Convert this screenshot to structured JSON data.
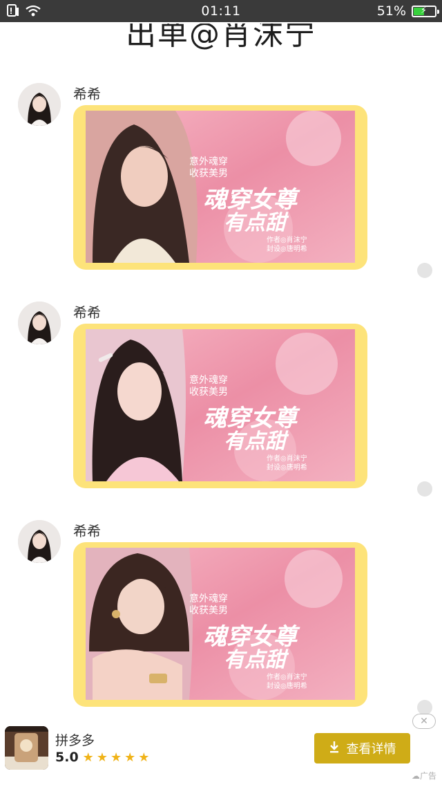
{
  "status_bar": {
    "time": "01:11",
    "battery": "51%",
    "battery_level": 0.51,
    "left_icons": [
      "notification-icon",
      "wifi-icon"
    ]
  },
  "page": {
    "title": "出单@肖沫宁"
  },
  "messages": [
    {
      "sender": "希希",
      "cover_text": {
        "line1": "意外魂穿",
        "line2": "收获美男",
        "main1": "魂穿女尊",
        "main2": "有点甜",
        "credit1": "作者◎肖沫宁",
        "credit2": "封设◎唐明希"
      }
    },
    {
      "sender": "希希",
      "cover_text": {
        "line1": "意外魂穿",
        "line2": "收获美男",
        "main1": "魂穿女尊",
        "main2": "有点甜",
        "credit1": "作者◎肖沫宁",
        "credit2": "封设◎唐明希"
      }
    },
    {
      "sender": "希希",
      "cover_text": {
        "line1": "意外魂穿",
        "line2": "收获美男",
        "main1": "魂穿女尊",
        "main2": "有点甜",
        "credit1": "作者◎肖沫宁",
        "credit2": "封设◎唐明希"
      }
    }
  ],
  "ad": {
    "app_name": "拼多多",
    "rating": "5.0",
    "stars": 5,
    "cta_label": "查看详情",
    "close_symbol": "✕",
    "ad_label": "广告"
  },
  "colors": {
    "bubble": "#fde37a",
    "cover_pink": "#f1a0b3",
    "cta": "#cfac17",
    "star": "#f0b318"
  }
}
